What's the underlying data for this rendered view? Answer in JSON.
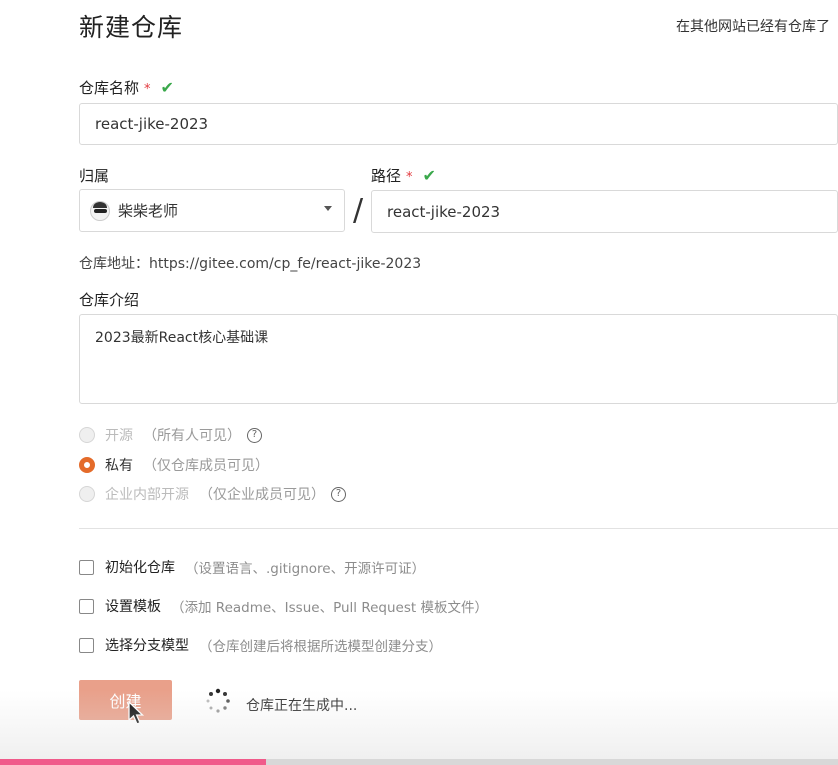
{
  "header": {
    "title": "新建仓库",
    "import_link": "在其他网站已经有仓库了"
  },
  "form": {
    "repo_name": {
      "label": "仓库名称",
      "required_mark": "*",
      "check": "✔",
      "value": "react-jike-2023"
    },
    "owner": {
      "label": "归属",
      "value": "柴柴老师"
    },
    "separator": "/",
    "path": {
      "label": "路径",
      "required_mark": "*",
      "check": "✔",
      "value": "react-jike-2023"
    },
    "address": {
      "label": "仓库地址：",
      "value": "https://gitee.com/cp_fe/react-jike-2023"
    },
    "description": {
      "label": "仓库介绍",
      "value": "2023最新React核心基础课"
    },
    "visibility": [
      {
        "label": "开源",
        "hint": "（所有人可见）",
        "help": "?",
        "selected": false,
        "enabled": false
      },
      {
        "label": "私有",
        "hint": "（仅仓库成员可见）",
        "selected": true,
        "enabled": true
      },
      {
        "label": "企业内部开源",
        "hint": "（仅企业成员可见）",
        "help": "?",
        "selected": false,
        "enabled": false
      }
    ],
    "options": [
      {
        "label": "初始化仓库",
        "hint": "（设置语言、.gitignore、开源许可证）"
      },
      {
        "label": "设置模板",
        "hint": "（添加 Readme、Issue、Pull Request 模板文件）"
      },
      {
        "label": "选择分支模型",
        "hint": "（仓库创建后将根据所选模型创建分支）"
      }
    ]
  },
  "actions": {
    "create_label": "创建",
    "status": "仓库正在生成中..."
  },
  "video_progress": 0.317,
  "colors": {
    "accent": "#e46b2a",
    "check": "#3aa84b",
    "required": "#e2383d",
    "button": "#e9a08a",
    "progress": "#f05a8a"
  }
}
